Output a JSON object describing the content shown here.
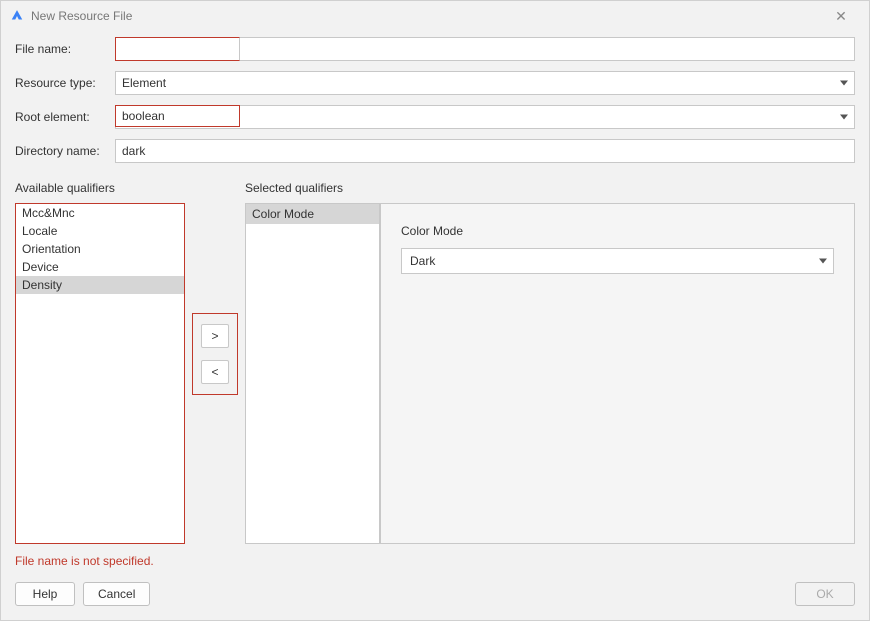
{
  "window": {
    "title": "New Resource File"
  },
  "form": {
    "file_name_label": "File name:",
    "file_name_value": "",
    "resource_type_label": "Resource type:",
    "resource_type_value": "Element",
    "root_element_label": "Root element:",
    "root_element_value": "boolean",
    "directory_name_label": "Directory name:",
    "directory_name_value": "dark"
  },
  "qualifiers": {
    "available_label": "Available qualifiers",
    "selected_label": "Selected qualifiers",
    "available_items": [
      "Mcc&Mnc",
      "Locale",
      "Orientation",
      "Device",
      "Density"
    ],
    "available_selected_index": 4,
    "selected_items": [
      "Color Mode"
    ],
    "move_right": ">",
    "move_left": "<"
  },
  "detail": {
    "label": "Color Mode",
    "value": "Dark"
  },
  "error_message": "File name is not specified.",
  "buttons": {
    "help": "Help",
    "cancel": "Cancel",
    "ok": "OK"
  }
}
